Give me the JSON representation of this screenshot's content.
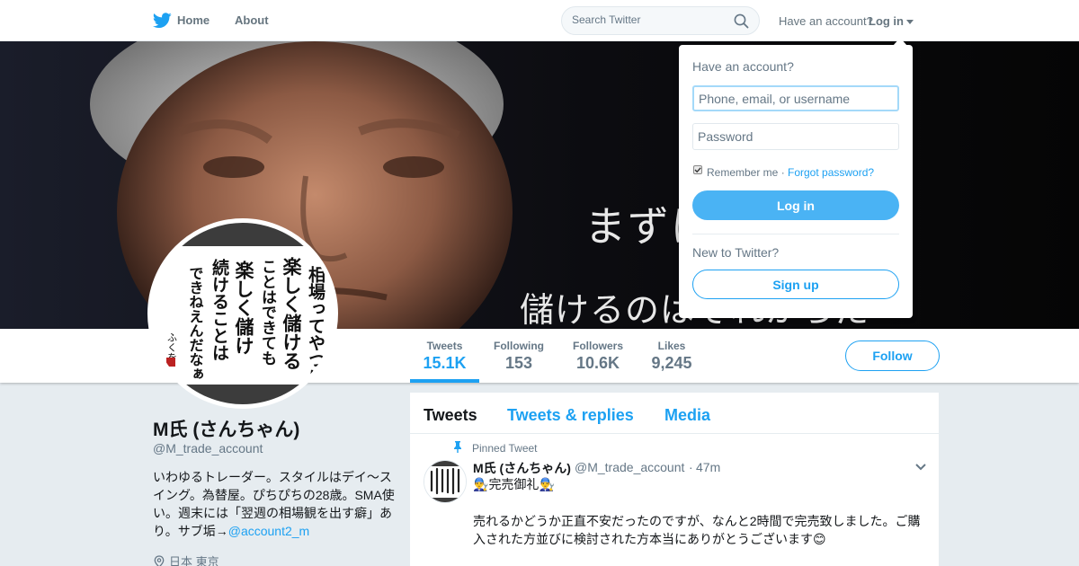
{
  "nav": {
    "home_label": "Home",
    "about_label": "About",
    "search_placeholder": "Search Twitter",
    "have_account_label": "Have an account?",
    "login_label": "Log in",
    "brand_color": "#1da1f2"
  },
  "banner": {
    "line1": "まずは",
    "line2": "儲けるのはそれからだ"
  },
  "avatar": {
    "calligraphy_lines": [
      "相場ってやつは",
      "楽しく儲ける",
      "ことはできても",
      "楽しく儲け",
      "続けることは",
      "できねえんだなぁ",
      "ふくを"
    ]
  },
  "stats": [
    {
      "label": "Tweets",
      "value": "15.1K",
      "active": true
    },
    {
      "label": "Following",
      "value": "153",
      "active": false
    },
    {
      "label": "Followers",
      "value": "10.6K",
      "active": false
    },
    {
      "label": "Likes",
      "value": "9,245",
      "active": false
    }
  ],
  "follow_label": "Follow",
  "profile": {
    "name": "M氏 (さんちゃん)",
    "handle": "@M_trade_account",
    "bio": "いわゆるトレーダー。スタイルはデイ～スイング。為替屋。ぴちぴちの28歳。SMA使い。週末には「翌週の相場観を出す癖」あり。サブ垢→",
    "bio_mention": "@account2_m",
    "location": "日本 東京"
  },
  "timeline": {
    "tabs": [
      "Tweets",
      "Tweets & replies",
      "Media"
    ],
    "pinned_label": "Pinned Tweet",
    "tweet": {
      "name": "M氏 (さんちゃん)",
      "handle": "@M_trade_account",
      "dot": "·",
      "time": "47m",
      "line1": "完売御礼",
      "line1_emoji": "👨‍🔧",
      "text": "売れるかどうか正直不安だったのですが、なんと2時間で完売致しました。ご購入された方並びに検討された方本当にありがとうございます",
      "text_emoji": "😊"
    }
  },
  "login_dropdown": {
    "title": "Have an account?",
    "username_placeholder": "Phone, email, or username",
    "password_placeholder": "Password",
    "remember_label": "Remember me ·",
    "forgot_label": "Forgot password?",
    "login_button": "Log in",
    "new_label": "New to Twitter?",
    "signup_button": "Sign up"
  }
}
